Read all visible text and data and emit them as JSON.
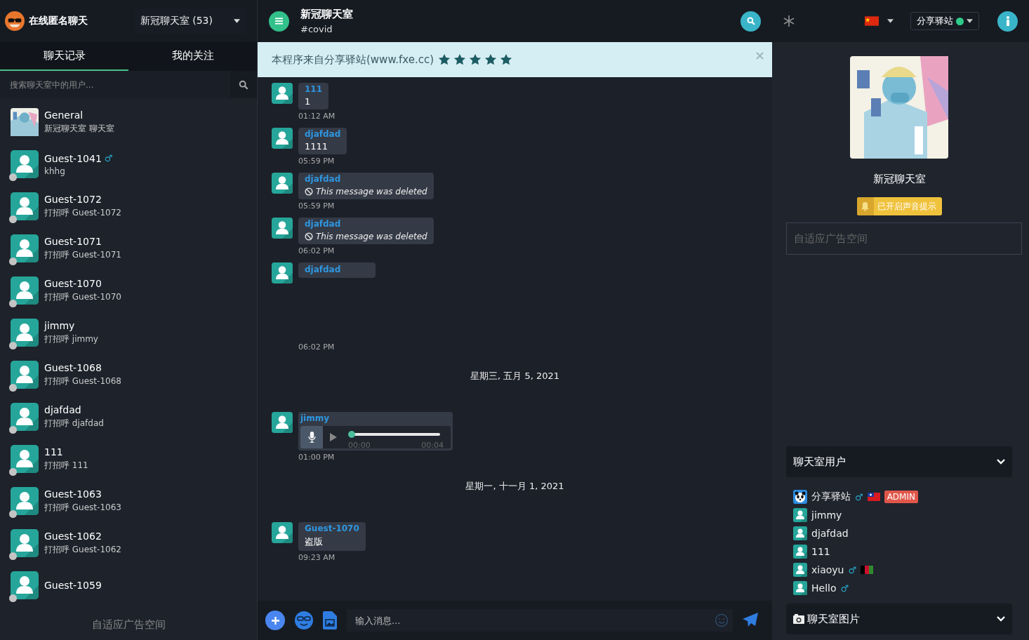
{
  "app": {
    "title": "在线匿名聊天",
    "room_select": "新冠聊天室 (53)"
  },
  "sidebar": {
    "tabs": [
      {
        "label": "聊天记录",
        "selected": true
      },
      {
        "label": "我的关注",
        "selected": false
      }
    ],
    "search": {
      "placeholder": "搜索聊天室中的用户..."
    },
    "items": [
      {
        "kind": "room",
        "name": "General",
        "subtitle": "新冠聊天室 聊天室"
      },
      {
        "kind": "user",
        "name": "Guest-1041",
        "gender_mark": "♂",
        "subtitle": "khhg",
        "online": false
      },
      {
        "kind": "user",
        "name": "Guest-1072",
        "subtitle": "打招呼 Guest-1072",
        "online": false
      },
      {
        "kind": "user",
        "name": "Guest-1071",
        "subtitle": "打招呼 Guest-1071",
        "online": false
      },
      {
        "kind": "user",
        "name": "Guest-1070",
        "subtitle": "打招呼 Guest-1070",
        "online": false
      },
      {
        "kind": "user",
        "name": "jimmy",
        "subtitle": "打招呼 jimmy",
        "online": false
      },
      {
        "kind": "user",
        "name": "Guest-1068",
        "subtitle": "打招呼 Guest-1068",
        "online": false
      },
      {
        "kind": "user",
        "name": "djafdad",
        "subtitle": "打招呼 djafdad",
        "online": false
      },
      {
        "kind": "user",
        "name": "111",
        "subtitle": "打招呼 111",
        "online": false
      },
      {
        "kind": "user",
        "name": "Guest-1063",
        "subtitle": "打招呼 Guest-1063",
        "online": false
      },
      {
        "kind": "user",
        "name": "Guest-1062",
        "subtitle": "打招呼 Guest-1062",
        "online": false
      },
      {
        "kind": "user",
        "name": "Guest-1059",
        "online": false
      }
    ],
    "ad": "自适应广告空间"
  },
  "chat": {
    "title": "新冠聊天室",
    "channel": "#covid",
    "notice": {
      "text": "本程序来自分享驿站(www.fxe.cc)",
      "stars": 5,
      "close": "×"
    },
    "messages": [
      {
        "kind": "text",
        "author": "111",
        "text": "1",
        "time": "01:12 AM"
      },
      {
        "kind": "text",
        "author": "djafdad",
        "text": "1111",
        "time": "05:59 PM"
      },
      {
        "kind": "deleted",
        "author": "djafdad",
        "text": "This message was deleted",
        "time": "05:59 PM"
      },
      {
        "kind": "deleted",
        "author": "djafdad",
        "text": "This message was deleted",
        "time": "06:02 PM"
      },
      {
        "kind": "blank",
        "author": "djafdad",
        "time": "06:02 PM"
      },
      {
        "kind": "date",
        "text": "星期三, 五月 5, 2021"
      },
      {
        "kind": "audio",
        "author": "jimmy",
        "level": 0,
        "elapsed": "00:00",
        "duration": "00:04",
        "time": "01:00 PM"
      },
      {
        "kind": "date",
        "text": "星期一, 十一月 1, 2021"
      },
      {
        "kind": "text",
        "author": "Guest-1070",
        "text": "盗版",
        "time": "09:23 AM"
      }
    ],
    "input": {
      "placeholder": "输入消息..."
    }
  },
  "topbar": {
    "account": "分享驿站",
    "account_online": true
  },
  "room": {
    "name": "新冠聊天室",
    "sound_button": "已开启声音提示",
    "ad": "自适应广告空间",
    "users_panel": {
      "title": "聊天室用户",
      "expanded": true,
      "users": [
        {
          "kind": "admin",
          "name": "分享驿站",
          "gender_mark": "♂",
          "flag": {
            "kind": "tw"
          },
          "badge": "ADMIN"
        },
        {
          "kind": "member",
          "name": "jimmy"
        },
        {
          "kind": "member",
          "name": "djafdad"
        },
        {
          "kind": "member",
          "name": "111"
        },
        {
          "kind": "member",
          "name": "xiaoyu",
          "gender_mark": "♂",
          "flag": {
            "kind": "af"
          }
        },
        {
          "kind": "member",
          "name": "Hello",
          "gender_mark": "♂"
        }
      ]
    },
    "images_panel": {
      "title": "聊天室图片"
    }
  }
}
